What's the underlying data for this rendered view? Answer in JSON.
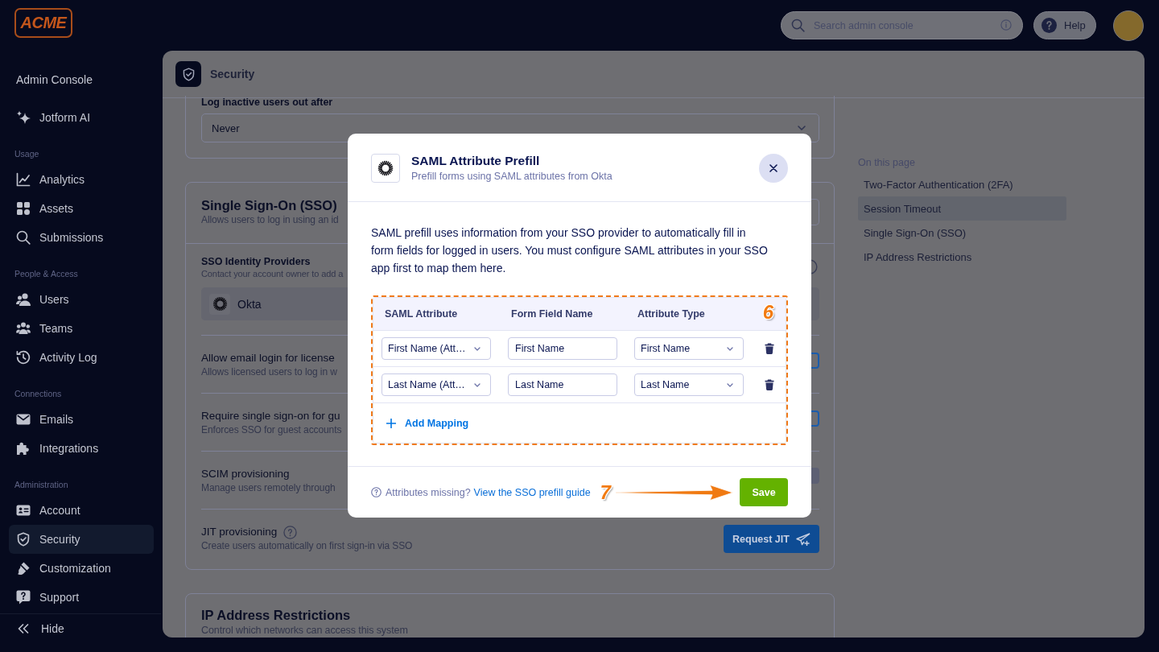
{
  "logo": {
    "text": "ACME"
  },
  "sidebar": {
    "title": "Admin Console",
    "sections": [
      {
        "items": [
          {
            "label": "Jotform AI",
            "selected": false
          }
        ]
      },
      {
        "label": "Usage",
        "items": [
          {
            "label": "Analytics",
            "selected": false
          },
          {
            "label": "Assets",
            "selected": false
          },
          {
            "label": "Submissions",
            "selected": false
          }
        ]
      },
      {
        "label": "People & Access",
        "items": [
          {
            "label": "Users",
            "selected": false
          },
          {
            "label": "Teams",
            "selected": false
          },
          {
            "label": "Activity Log",
            "selected": false
          }
        ]
      },
      {
        "label": "Connections",
        "items": [
          {
            "label": "Emails",
            "selected": false
          },
          {
            "label": "Integrations",
            "selected": false
          }
        ]
      },
      {
        "label": "Administration",
        "items": [
          {
            "label": "Account",
            "selected": false
          },
          {
            "label": "Security",
            "selected": true
          },
          {
            "label": "Customization",
            "selected": false
          },
          {
            "label": "Support",
            "selected": false
          }
        ]
      }
    ],
    "hide_label": "Hide"
  },
  "header": {
    "search": {
      "placeholder": "Search admin console"
    },
    "help_button": "Help"
  },
  "page": {
    "title": "Security"
  },
  "session_timeout": {
    "label": "Log inactive users out after",
    "value": "Never"
  },
  "sso": {
    "title": "Single Sign-On (SSO)",
    "subtitle": "Allows users to log in using an id",
    "providers": {
      "title": "SSO Identity Providers",
      "subtitle": "Contact your account owner to add a",
      "items": [
        {
          "name": "Okta"
        }
      ]
    },
    "settings": [
      {
        "kind": "toggle",
        "title": "Allow email login for license",
        "subtitle": "Allows licensed users to log in w",
        "help_icon": false
      },
      {
        "kind": "toggle",
        "title": "Require single sign-on for gu",
        "subtitle": "Enforces SSO for guest accounts",
        "help_icon": false
      },
      {
        "kind": "button-edge",
        "title": "SCIM provisioning",
        "subtitle": "Manage users remotely through",
        "help_icon": false
      },
      {
        "kind": "button",
        "title": "JIT provisioning",
        "subtitle": "Create users automatically on first sign-in via SSO",
        "help_icon": true,
        "button": "Request JIT"
      }
    ]
  },
  "ip_restrictions": {
    "title": "IP Address Restrictions",
    "subtitle": "Control which networks can access this system"
  },
  "on_this_page": {
    "title": "On this page",
    "items": [
      {
        "label": "Two-Factor Authentication (2FA)",
        "selected": false
      },
      {
        "label": "Session Timeout",
        "selected": true
      },
      {
        "label": "Single Sign-On (SSO)",
        "selected": false
      },
      {
        "label": "IP Address Restrictions",
        "selected": false
      }
    ]
  },
  "modal": {
    "title": "SAML Attribute Prefill",
    "subtitle": "Prefill forms using SAML attributes from Okta",
    "description": "SAML prefill uses information from your SSO provider to automatically fill in form fields for logged in users. You must configure SAML attributes in your SSO app first to map them here.",
    "table": {
      "columns": [
        "SAML Attribute",
        "Form Field Name",
        "Attribute Type"
      ],
      "rows": [
        {
          "saml_attribute": "First Name (Att…",
          "form_field_name": "First Name",
          "attribute_type": "First Name"
        },
        {
          "saml_attribute": "Last Name (Att…",
          "form_field_name": "Last Name",
          "attribute_type": "Last Name"
        }
      ],
      "add_label": "Add Mapping",
      "callout": "6"
    },
    "footer": {
      "hint": "Attributes missing?",
      "link": "View the SSO prefill guide",
      "callout": "7",
      "save_button": "Save"
    }
  }
}
